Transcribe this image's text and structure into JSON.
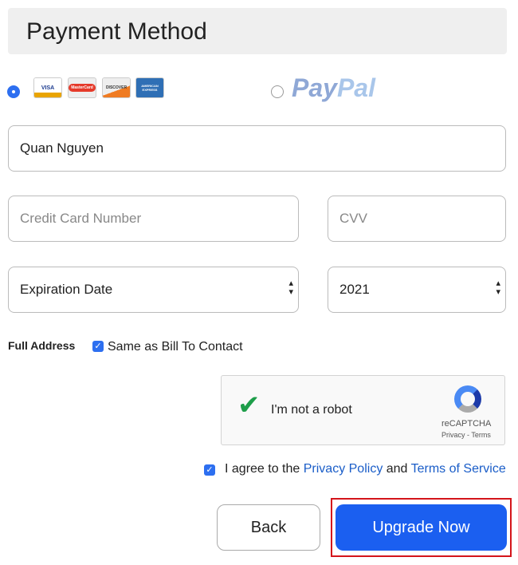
{
  "header": {
    "title": "Payment Method"
  },
  "payment_options": {
    "cards": [
      "VISA",
      "MasterCard",
      "DISCOVER",
      "AMERICAN EXPRESS"
    ],
    "paypal_label_a": "Pay",
    "paypal_label_b": "Pal",
    "selected": "card"
  },
  "form": {
    "name_value": "Quan Nguyen",
    "card_number_placeholder": "Credit Card Number",
    "cvv_placeholder": "CVV",
    "expiration_value": "Expiration Date",
    "year_value": "2021",
    "address_label": "Full Address",
    "same_as_bill_label": "Same as Bill To Contact",
    "same_as_bill_checked": true
  },
  "captcha": {
    "label": "I'm not a robot",
    "brand": "reCAPTCHA",
    "privacy": "Privacy",
    "sep": " - ",
    "terms": "Terms",
    "checked": true
  },
  "agree": {
    "prefix": "I agree to the ",
    "privacy_link": "Privacy Policy",
    "mid": " and ",
    "terms_link": "Terms of Service",
    "checked": true
  },
  "buttons": {
    "back": "Back",
    "upgrade": "Upgrade Now"
  },
  "colors": {
    "primary": "#1b5ff0",
    "highlight": "#d4151b"
  }
}
